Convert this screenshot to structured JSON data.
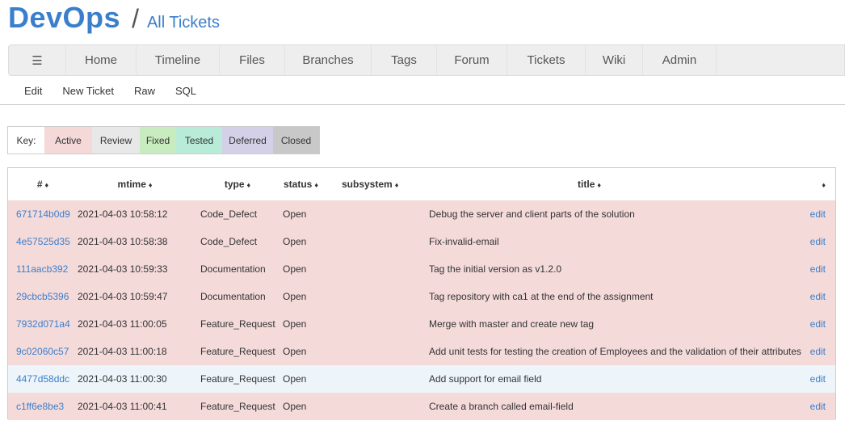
{
  "header": {
    "logo": "DevOps",
    "separator": "/",
    "page_title": "All Tickets"
  },
  "mainmenu": {
    "hamburger": "☰",
    "items": [
      "Home",
      "Timeline",
      "Files",
      "Branches",
      "Tags",
      "Forum",
      "Tickets",
      "Wiki",
      "Admin"
    ]
  },
  "submenu": {
    "items": [
      "Edit",
      "New Ticket",
      "Raw",
      "SQL"
    ]
  },
  "key": {
    "label": "Key:",
    "entries": [
      "Active",
      "Review",
      "Fixed",
      "Tested",
      "Deferred",
      "Closed"
    ],
    "colors": {
      "Active": "#f5d8d8",
      "Review": "#e8e8e8",
      "Fixed": "#c8ecbf",
      "Tested": "#b8ebd8",
      "Deferred": "#d4d0e8",
      "Closed": "#c8c8c8"
    }
  },
  "table": {
    "headers": [
      "#",
      "mtime",
      "type",
      "status",
      "subsystem",
      "title",
      ""
    ],
    "sort_icon": "♦",
    "rows": [
      {
        "id": "671714b0d9",
        "mtime": "2021-04-03 10:58:12",
        "type": "Code_Defect",
        "status": "Open",
        "subsystem": "",
        "title": "Debug the server and client parts of the solution",
        "edit": "edit",
        "state": "active"
      },
      {
        "id": "4e57525d35",
        "mtime": "2021-04-03 10:58:38",
        "type": "Code_Defect",
        "status": "Open",
        "subsystem": "",
        "title": "Fix-invalid-email",
        "edit": "edit",
        "state": "active"
      },
      {
        "id": "111aacb392",
        "mtime": "2021-04-03 10:59:33",
        "type": "Documentation",
        "status": "Open",
        "subsystem": "",
        "title": "Tag the initial version as v1.2.0",
        "edit": "edit",
        "state": "active"
      },
      {
        "id": "29cbcb5396",
        "mtime": "2021-04-03 10:59:47",
        "type": "Documentation",
        "status": "Open",
        "subsystem": "",
        "title": "Tag repository with ca1 at the end of the assignment",
        "edit": "edit",
        "state": "active"
      },
      {
        "id": "7932d071a4",
        "mtime": "2021-04-03 11:00:05",
        "type": "Feature_Request",
        "status": "Open",
        "subsystem": "",
        "title": "Merge with master and create new tag",
        "edit": "edit",
        "state": "active"
      },
      {
        "id": "9c02060c57",
        "mtime": "2021-04-03 11:00:18",
        "type": "Feature_Request",
        "status": "Open",
        "subsystem": "",
        "title": "Add unit tests for testing the creation of Employees and the validation of their attributes",
        "edit": "edit",
        "state": "active"
      },
      {
        "id": "4477d58ddc",
        "mtime": "2021-04-03 11:00:30",
        "type": "Feature_Request",
        "status": "Open",
        "subsystem": "",
        "title": "Add support for email field",
        "edit": "edit",
        "state": "review"
      },
      {
        "id": "c1ff6e8be3",
        "mtime": "2021-04-03 11:00:41",
        "type": "Feature_Request",
        "status": "Open",
        "subsystem": "",
        "title": "Create a branch called email-field",
        "edit": "edit",
        "state": "active"
      }
    ]
  }
}
